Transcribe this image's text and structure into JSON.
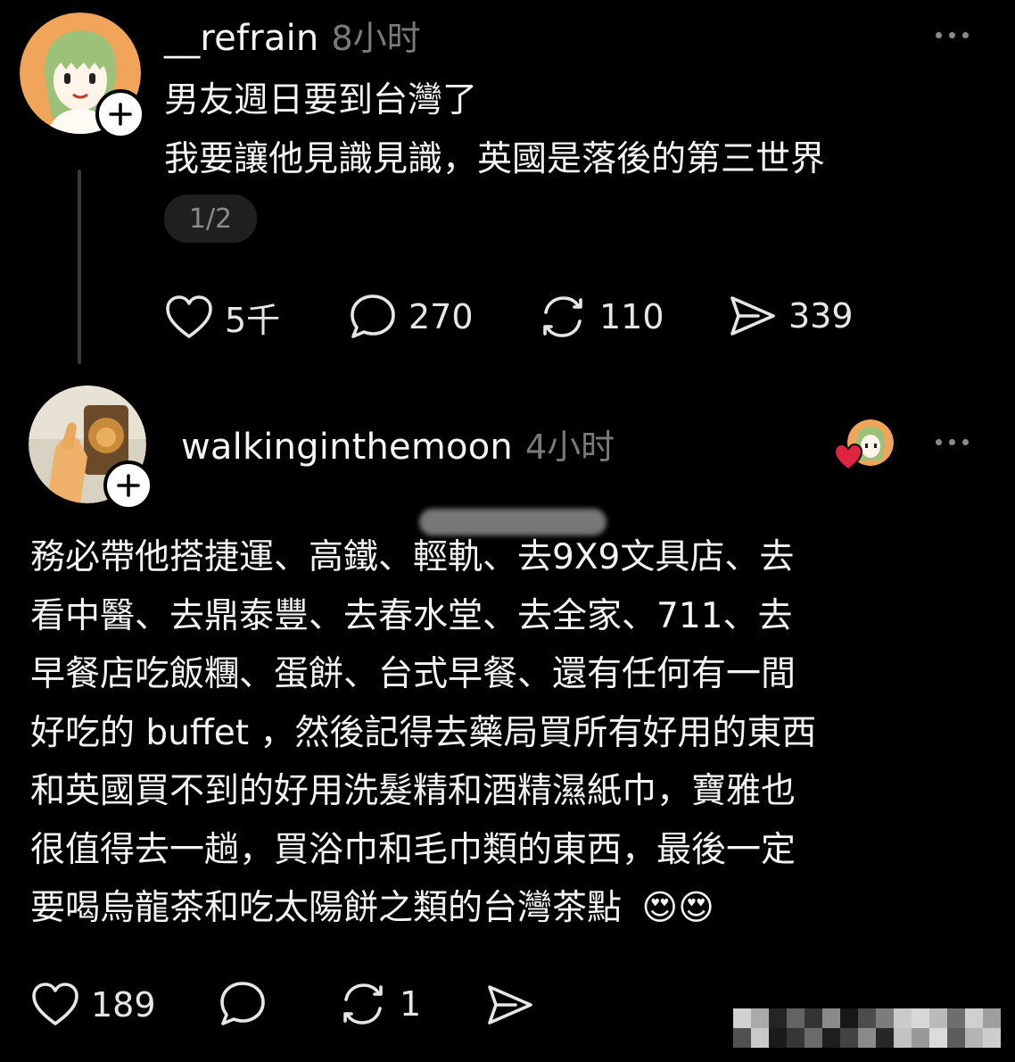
{
  "post": {
    "username": "__refrain",
    "time": "8小时",
    "lines": [
      "男友週日要到台灣了",
      "我要讓他見識見識，英國是落後的第三世界"
    ],
    "page_indicator": "1/2",
    "likes": "5千",
    "comments": "270",
    "reposts": "110",
    "shares": "339"
  },
  "reply": {
    "username": "walkinginthemoon",
    "time": "4小时",
    "lines": [
      "務必帶他搭捷運、高鐵、輕軌、去9X9文具店、去",
      "看中醫、去鼎泰豐、去春水堂、去全家、711、去",
      "早餐店吃飯糰、蛋餅、台式早餐、還有任何有一間",
      "好吃的 buffet ，然後記得去藥局買所有好用的東西",
      "和英國買不到的好用洗髮精和酒精濕紙巾，寶雅也",
      "很值得去一趟，買浴巾和毛巾類的東西，最後一定",
      "要喝烏龍茶和吃太陽餅之類的台灣茶點"
    ],
    "emoji": "😍😍",
    "likes": "189",
    "reposts": "1"
  },
  "icons": {
    "like": "heart-icon",
    "comment": "comment-bubble-icon",
    "repost": "repost-icon",
    "share": "send-icon",
    "more": "more-dots-icon",
    "follow": "plus-icon",
    "liked_by_author": "heart-badge-icon"
  },
  "colors": {
    "background": "#000000",
    "text": "#f3f3f3",
    "muted": "#7a7a7a",
    "heart_badge": "#e0243f"
  }
}
